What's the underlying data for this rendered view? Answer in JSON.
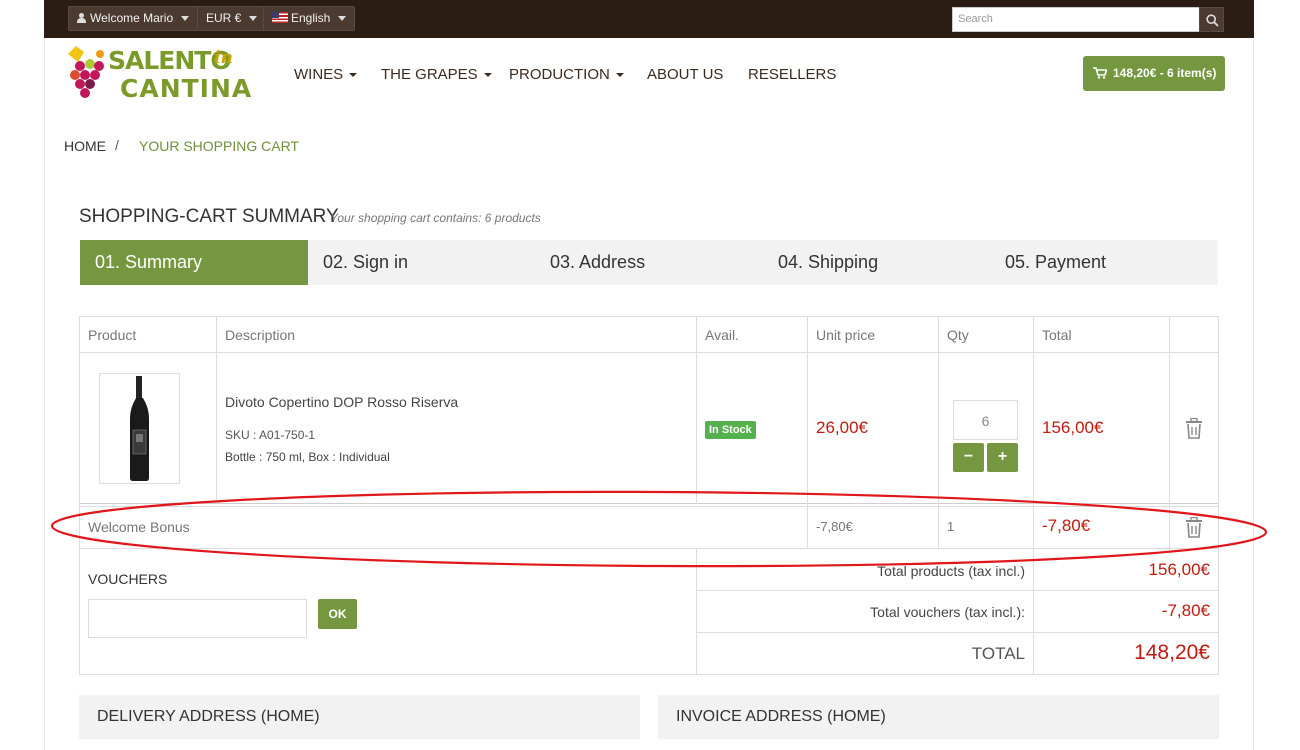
{
  "topbar": {
    "welcome": "Welcome Mario",
    "currency": "EUR €",
    "language": "English",
    "search_placeholder": "Search"
  },
  "logo": {
    "line1": "SALENTO",
    "accent": "in",
    "line2": "CANTINA"
  },
  "nav": {
    "items": [
      "WINES",
      "THE GRAPES",
      "PRODUCTION",
      "ABOUT US",
      "RESELLERS"
    ]
  },
  "cart_button": "148,20€ - 6 item(s)",
  "breadcrumb": {
    "home": "HOME",
    "separator": "/",
    "current": "YOUR SHOPPING CART"
  },
  "summary": {
    "title": "SHOPPING-CART SUMMARY",
    "subtitle": "Your shopping cart contains: 6 products"
  },
  "steps": [
    "01. Summary",
    "02. Sign in",
    "03. Address",
    "04. Shipping",
    "05. Payment"
  ],
  "table": {
    "headers": [
      "Product",
      "Description",
      "Avail.",
      "Unit price",
      "Qty",
      "Total"
    ],
    "product": {
      "name": "Divoto Copertino DOP Rosso Riserva",
      "sku": "SKU : A01-750-1",
      "attributes": "Bottle : 750 ml, Box : Individual",
      "availability": "In Stock",
      "unit_price": "26,00€",
      "qty": "6",
      "total": "156,00€"
    },
    "voucher_row": {
      "name": "Welcome Bonus",
      "unit_price": "-7,80€",
      "qty": "1",
      "total": "-7,80€"
    }
  },
  "vouchers": {
    "title": "VOUCHERS",
    "ok_label": "OK"
  },
  "totals": {
    "products_label": "Total products (tax incl.)",
    "products_value": "156,00€",
    "vouchers_label": "Total vouchers (tax incl.):",
    "vouchers_value": "-7,80€",
    "total_label": "TOTAL",
    "total_value": "148,20€"
  },
  "addresses": {
    "delivery": "DELIVERY ADDRESS (HOME)",
    "invoice": "INVOICE ADDRESS (HOME)"
  },
  "colors": {
    "brand_green": "#75973f",
    "price_red": "#c01b0f",
    "topbar": "#2b1d14",
    "annotation_red": "#e0161b"
  }
}
